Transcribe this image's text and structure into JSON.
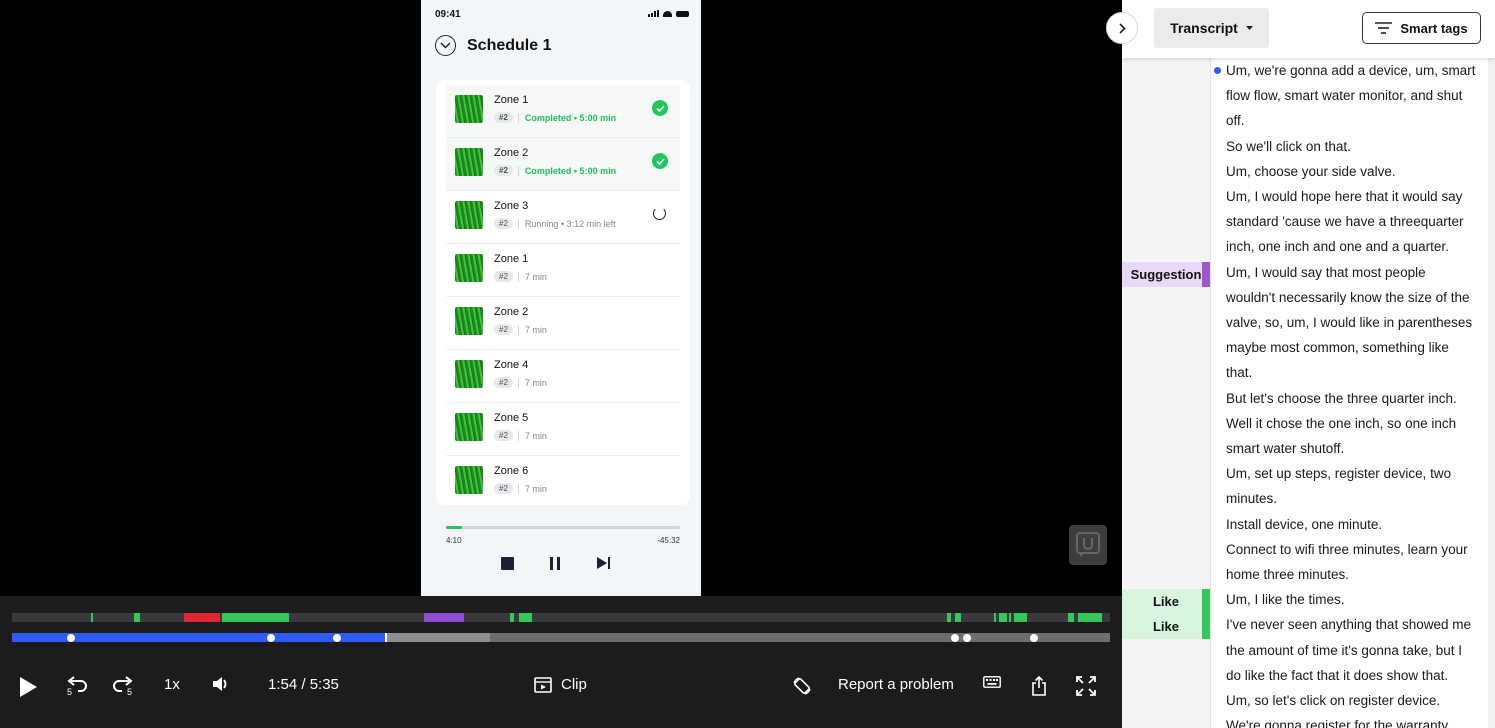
{
  "phone": {
    "status_time": "09:41",
    "schedule_title": "Schedule 1",
    "zones": [
      {
        "name": "Zone 1",
        "badge": "#2",
        "status": "Completed • 5:00 min",
        "state": "completed"
      },
      {
        "name": "Zone 2",
        "badge": "#2",
        "status": "Completed • 5:00 min",
        "state": "completed"
      },
      {
        "name": "Zone 3",
        "badge": "#2",
        "status": "Running • 3:12 min left",
        "state": "running"
      },
      {
        "name": "Zone 1",
        "badge": "#2",
        "status": "7 min",
        "state": "pending"
      },
      {
        "name": "Zone 2",
        "badge": "#2",
        "status": "7 min",
        "state": "pending"
      },
      {
        "name": "Zone 4",
        "badge": "#2",
        "status": "7 min",
        "state": "pending"
      },
      {
        "name": "Zone 5",
        "badge": "#2",
        "status": "7 min",
        "state": "pending"
      },
      {
        "name": "Zone 6",
        "badge": "#2",
        "status": "7 min",
        "state": "pending"
      }
    ],
    "player": {
      "elapsed": "4:10",
      "remaining": "-45:32",
      "progress": 0.07
    },
    "accent": "#22c55e"
  },
  "video_player": {
    "current_time": "1:54 / 5:35",
    "speed": "1x",
    "clip_label": "Clip",
    "report_label": "Report a problem",
    "progress": 0.34,
    "buffered": 0.435,
    "tag_segments": [
      {
        "start": 0.072,
        "end": 0.074,
        "color": "#34c759"
      },
      {
        "start": 0.111,
        "end": 0.117,
        "color": "#34c759"
      },
      {
        "start": 0.157,
        "end": 0.189,
        "color": "#e0262e"
      },
      {
        "start": 0.191,
        "end": 0.252,
        "color": "#34c759"
      },
      {
        "start": 0.375,
        "end": 0.412,
        "color": "#8e4bd1"
      },
      {
        "start": 0.454,
        "end": 0.457,
        "color": "#34c759"
      },
      {
        "start": 0.462,
        "end": 0.474,
        "color": "#34c759"
      },
      {
        "start": 0.852,
        "end": 0.855,
        "color": "#34c759"
      },
      {
        "start": 0.859,
        "end": 0.864,
        "color": "#34c759"
      },
      {
        "start": 0.894,
        "end": 0.896,
        "color": "#34c759"
      },
      {
        "start": 0.899,
        "end": 0.906,
        "color": "#34c759"
      },
      {
        "start": 0.908,
        "end": 0.91,
        "color": "#34c759"
      },
      {
        "start": 0.913,
        "end": 0.924,
        "color": "#34c759"
      },
      {
        "start": 0.962,
        "end": 0.967,
        "color": "#34c759"
      },
      {
        "start": 0.971,
        "end": 0.993,
        "color": "#34c759"
      }
    ],
    "markers": [
      0.054,
      0.236,
      0.296,
      0.859,
      0.87,
      0.931
    ],
    "progress_color": "#2e5bff"
  },
  "panel": {
    "tab_label": "Transcript",
    "smart_tags_label": "Smart tags",
    "tags": [
      {
        "label": "Suggestion",
        "row": 8,
        "bg": "#e9d8f7",
        "bar": "#9b59d0"
      },
      {
        "label": "Like",
        "row": 21,
        "bg": "#d6f5dc",
        "bar": "#34c759"
      },
      {
        "label": "Like",
        "row": 22,
        "bg": "#d6f5dc",
        "bar": "#34c759"
      }
    ],
    "lines": [
      "Um, we're gonna add a device, um, smart",
      "flow flow, smart water monitor, and shut",
      "off.",
      "So we'll click on that.",
      "Um, choose your side valve.",
      "Um, I would hope here that it would say",
      "standard 'cause we have a threequarter",
      "inch, one inch and one and a quarter.",
      "Um, I would say that most people",
      "wouldn't necessarily know the size of the",
      "valve, so, um, I would like in parentheses",
      "maybe most common, something like",
      "that.",
      "But let's choose the three quarter inch.",
      "Well it chose the one inch, so one inch",
      "smart water shutoff.",
      "Um, set up steps, register device, two",
      "minutes.",
      "Install device, one minute.",
      "Connect to wifi three minutes, learn your",
      "home three minutes.",
      "Um, I like the times.",
      "I've never seen anything that showed me",
      "the amount of time it's gonna take, but I",
      "do like the fact that it does show that.",
      "Um, so let's click on register device.",
      "We're gonna register for the warranty"
    ]
  }
}
